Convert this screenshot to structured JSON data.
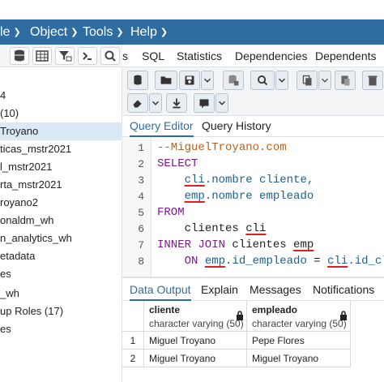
{
  "menubar": {
    "items": [
      {
        "label": "le",
        "chevron": true
      },
      {
        "label": "Object",
        "chevron": true
      },
      {
        "label": "Tools",
        "chevron": true
      },
      {
        "label": "Help",
        "chevron": true
      }
    ]
  },
  "sidebar": {
    "items": [
      {
        "label": "4"
      },
      {
        "label": "(10)"
      },
      {
        "label": "Troyano",
        "selected": true
      },
      {
        "label": "ticas_mstr2021"
      },
      {
        "label": "l_mstr2021"
      },
      {
        "label": "rta_mstr2021"
      },
      {
        "label": "royano2"
      },
      {
        "label": "onaldm_wh"
      },
      {
        "label": "n_analytics_wh"
      },
      {
        "label": "etadata"
      },
      {
        "label": "es"
      },
      {
        "label": "_wh"
      },
      {
        "label": "up Roles (17)"
      },
      {
        "label": "es"
      }
    ]
  },
  "toptabs": [
    "s",
    "SQL",
    "Statistics",
    "Dependencies",
    "Dependents"
  ],
  "editor_tabs": {
    "active": "Query Editor",
    "other": "Query History"
  },
  "editor": {
    "line_numbers": [
      "1",
      "2",
      "3",
      "4",
      "5",
      "6",
      "7",
      "8"
    ],
    "line1": "--MiguelTroyano.com",
    "select_kw": "SELECT",
    "l3_alias": "cli",
    "l3_rest": ".nombre cliente,",
    "l4_alias": "emp",
    "l4_rest": ".nombre empleado",
    "from_kw": "FROM",
    "l6_table": "clientes",
    "l6_alias": "cli",
    "l7_kw": "INNER JOIN",
    "l7_table": "clientes",
    "l7_alias": "emp",
    "l8_on": "ON",
    "l8_a1": "emp",
    "l8_c1": ".id_empleado",
    "l8_eq": "=",
    "l8_a2": "cli",
    "l8_c2": ".id_clie"
  },
  "results_tabs": [
    "Data Output",
    "Explain",
    "Messages",
    "Notifications"
  ],
  "results": {
    "columns": [
      {
        "name": "cliente",
        "type": "character varying (50)"
      },
      {
        "name": "empleado",
        "type": "character varying (50)"
      }
    ],
    "rows": [
      {
        "num": "1",
        "cliente": "Miguel Troyano",
        "empleado": "Pepe Flores"
      },
      {
        "num": "2",
        "cliente": "Miguel Troyano",
        "empleado": "Miguel Troyano"
      }
    ]
  },
  "colors": {
    "menubar": "#2f6c9f",
    "accent": "#2f6c9f",
    "underline": "#e02020"
  }
}
